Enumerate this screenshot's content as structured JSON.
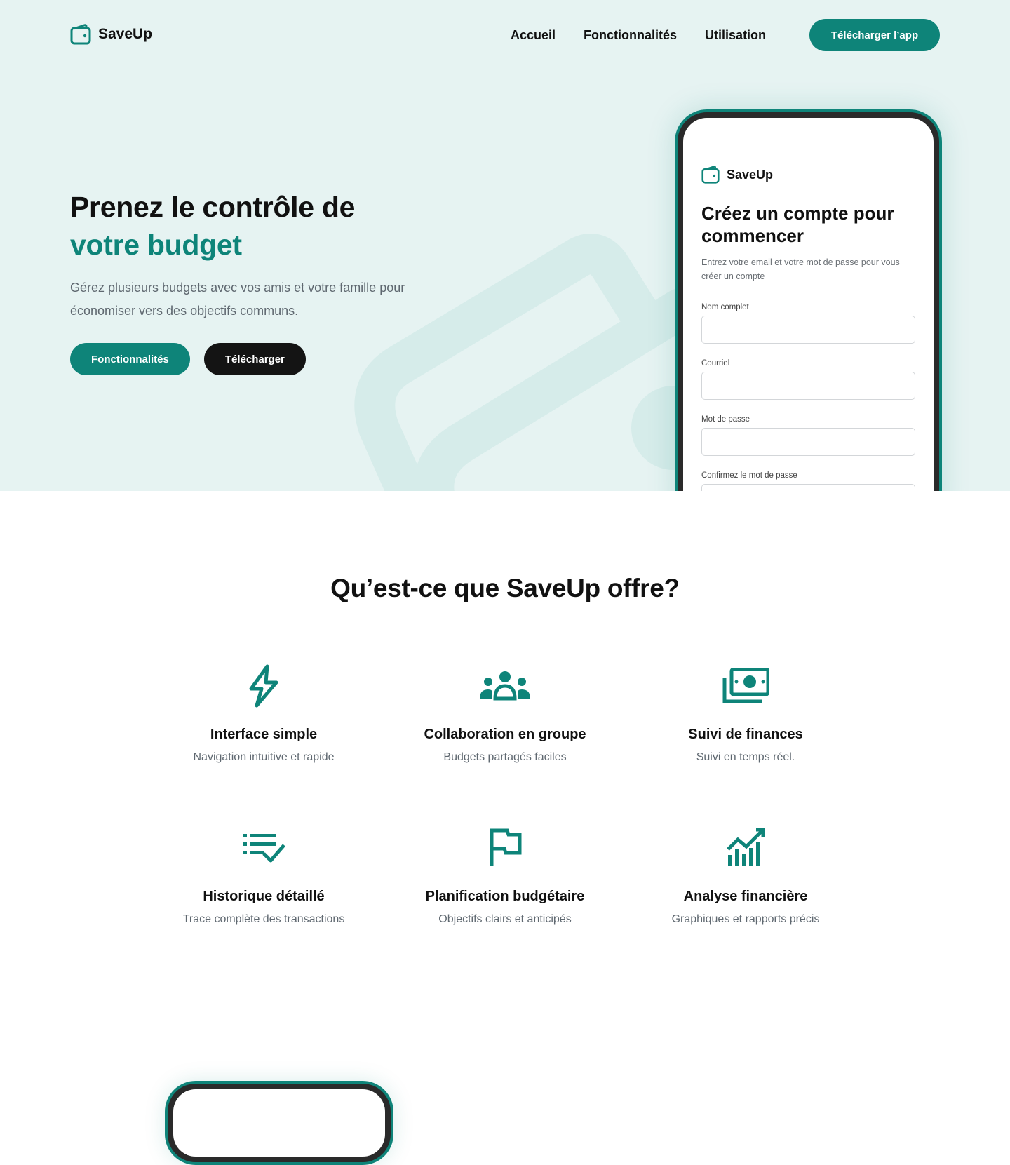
{
  "brand": {
    "name": "SaveUp",
    "accent": "#0e8479",
    "logo_icon": "wallet-icon"
  },
  "nav": {
    "links": [
      "Accueil",
      "Fonctionnalités",
      "Utilisation"
    ],
    "cta": "Télécharger l’app"
  },
  "hero": {
    "title_line1": "Prenez le contrôle de",
    "title_line2": "votre budget",
    "subtitle": "Gérez plusieurs budgets avec vos amis et votre famille pour économiser vers des objectifs communs.",
    "btn_features": "Fonctionnalités",
    "btn_download": "Télécharger"
  },
  "phone": {
    "logo_text": "SaveUp",
    "title": "Créez un compte pour commencer",
    "subtitle": "Entrez votre email et votre mot de passe pour vous créer un compte",
    "fields": [
      {
        "label": "Nom complet",
        "value": ""
      },
      {
        "label": "Courriel",
        "value": ""
      },
      {
        "label": "Mot de passe",
        "value": ""
      },
      {
        "label": "Confirmez le mot de passe",
        "value": ""
      }
    ]
  },
  "features": {
    "title": "Qu’est-ce que SaveUp offre?",
    "items": [
      {
        "icon": "lightning-icon",
        "title": "Interface simple",
        "desc": "Navigation intuitive et rapide"
      },
      {
        "icon": "group-icon",
        "title": "Collaboration en groupe",
        "desc": "Budgets partagés faciles"
      },
      {
        "icon": "money-icon",
        "title": "Suivi de finances",
        "desc": "Suivi en temps réel."
      },
      {
        "icon": "checklist-icon",
        "title": "Historique détaillé",
        "desc": "Trace complète des transactions"
      },
      {
        "icon": "flag-icon",
        "title": "Planification budgétaire",
        "desc": "Objectifs clairs et anticipés"
      },
      {
        "icon": "chart-icon",
        "title": "Analyse financière",
        "desc": "Graphiques et rapports précis"
      }
    ]
  }
}
